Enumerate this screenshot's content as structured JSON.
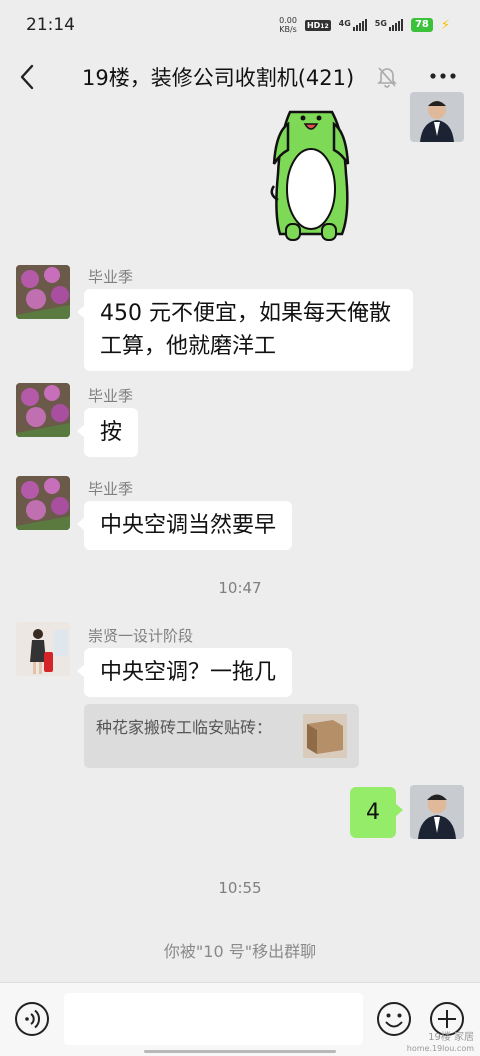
{
  "status_bar": {
    "time": "21:14",
    "net_speed_value": "0.00",
    "net_speed_unit": "KB/s",
    "hd_label": "HD",
    "sim_index": "12",
    "signal1_label": "4G",
    "signal2_label": "5G",
    "battery": "78"
  },
  "header": {
    "title": "19楼，装修公司收割机(421)",
    "back_icon": "chevron-left-icon",
    "mute_icon": "bell-muted-icon",
    "more_icon": "ellipsis-icon"
  },
  "messages": [
    {
      "type": "sticker",
      "from": "me",
      "sticker": "green-dog-sticker"
    },
    {
      "type": "text",
      "from": "other",
      "sender": "毕业季",
      "text_line1": "450 元不便宜，如果每天俺散",
      "text_line2": "工算，他就磨洋工"
    },
    {
      "type": "text",
      "from": "other",
      "sender": "毕业季",
      "text": "按"
    },
    {
      "type": "text",
      "from": "other",
      "sender": "毕业季",
      "text": "中央空调当然要早"
    },
    {
      "type": "time",
      "text": "10:47"
    },
    {
      "type": "text",
      "from": "other",
      "sender": "崇贤一设计阶段",
      "text": "中央空调？一拖几",
      "quote": "种花家搬砖工临安贴砖："
    },
    {
      "type": "text",
      "from": "me",
      "text": "4"
    },
    {
      "type": "time",
      "text": "10:55"
    },
    {
      "type": "system",
      "text": "你被\"10 号\"移出群聊"
    }
  ],
  "input_bar": {
    "voice_icon": "voice-icon",
    "emoji_icon": "emoji-icon",
    "plus_icon": "plus-icon"
  },
  "watermark": {
    "line1": "19楼 家居",
    "line2": "home.19lou.com"
  },
  "colors": {
    "background": "#ededed",
    "my_bubble": "#95ec69",
    "other_bubble": "#ffffff",
    "sticker_green": "#7ed957",
    "battery_green": "#3cc13b"
  }
}
